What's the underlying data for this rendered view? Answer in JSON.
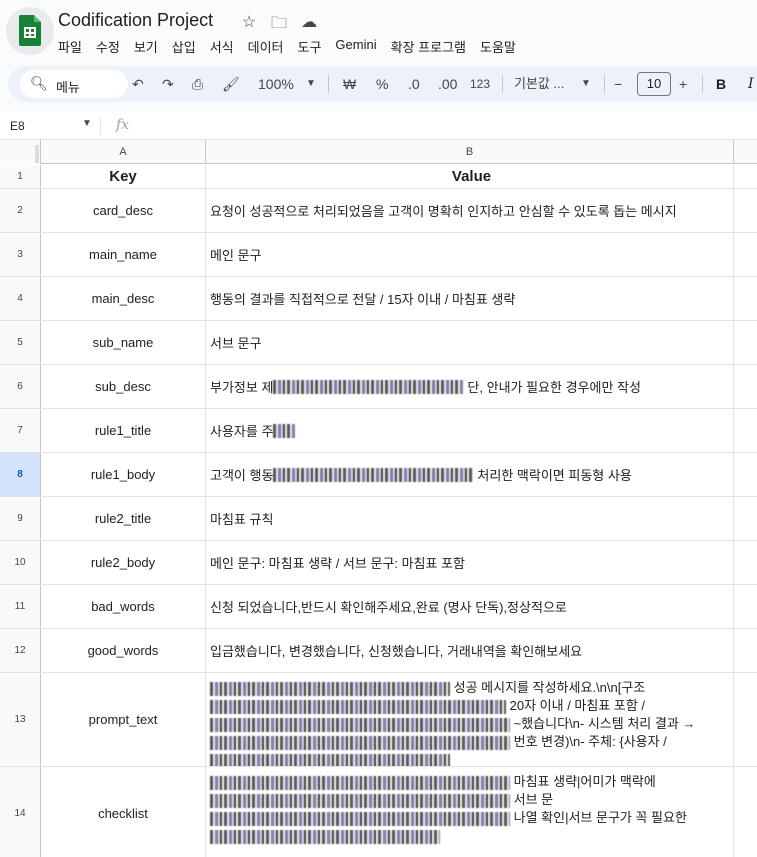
{
  "doc": {
    "title": "Codification Project"
  },
  "menu": [
    "파일",
    "수정",
    "보기",
    "삽입",
    "서식",
    "데이터",
    "도구",
    "Gemini",
    "확장 프로그램",
    "도움말"
  ],
  "toolbar": {
    "search_label": "메뉴",
    "zoom": "100%",
    "currency": "₩",
    "percent": "%",
    "dec_decrease": ".0",
    "dec_increase": ".00",
    "number_format": "123",
    "font": "기본값 ...",
    "minus": "−",
    "font_size": "10",
    "plus": "+",
    "bold": "B",
    "italic": "I"
  },
  "formula_bar": {
    "name_box": "E8",
    "fx": "fx"
  },
  "columns": [
    "A",
    "B"
  ],
  "rows": [
    {
      "num": "1",
      "key": "Key",
      "value": "Value"
    },
    {
      "num": "2",
      "key": "card_desc",
      "value": "요청이 성공적으로 처리되었음을 고객이 명확히 인지하고 안심할 수 있도록 돕는 메시지"
    },
    {
      "num": "3",
      "key": "main_name",
      "value": "메인 문구"
    },
    {
      "num": "4",
      "key": "main_desc",
      "value": "행동의 결과를 직접적으로 전달 / 15자 이내 / 마침표 생략"
    },
    {
      "num": "5",
      "key": "sub_name",
      "value": "서브 문구"
    },
    {
      "num": "6",
      "key": "sub_desc",
      "value_pre": "부가정보 제",
      "value_post": "단, 안내가 필요한 경우에만 작성"
    },
    {
      "num": "7",
      "key": "rule1_title",
      "value_pre": "사용자를 주",
      "value_post": ""
    },
    {
      "num": "8",
      "key": "rule1_body",
      "value_pre": "고객이 행동",
      "value_post": "처리한 맥락이면 피동형 사용"
    },
    {
      "num": "9",
      "key": "rule2_title",
      "value": "마침표 규칙"
    },
    {
      "num": "10",
      "key": "rule2_body",
      "value": "메인 문구: 마침표 생략 / 서브 문구: 마침표 포함"
    },
    {
      "num": "11",
      "key": "bad_words",
      "value": "신청 되었습니다,반드시 확인해주세요,완료 (명사 단독),정상적으로"
    },
    {
      "num": "12",
      "key": "good_words",
      "value": "입금했습니다, 변경했습니다, 신청했습니다, 거래내역을 확인해보세요"
    },
    {
      "num": "13",
      "key": "prompt_text",
      "value_lines": [
        "성공 메시지를 작성하세요.\\n\\n[구조",
        "20자 이내 / 마침표 포함 /",
        "~했습니다\\n- 시스템 처리 결과 →",
        "번호 변경)\\n- 주체: {사용자 /",
        ""
      ]
    },
    {
      "num": "14",
      "key": "checklist",
      "value_lines": [
        "마침표 생략|어미가 맥락에",
        "서브 문",
        "나열 확인|서브 문구가 꼭 필요한",
        ""
      ]
    }
  ],
  "selected_row": "8"
}
